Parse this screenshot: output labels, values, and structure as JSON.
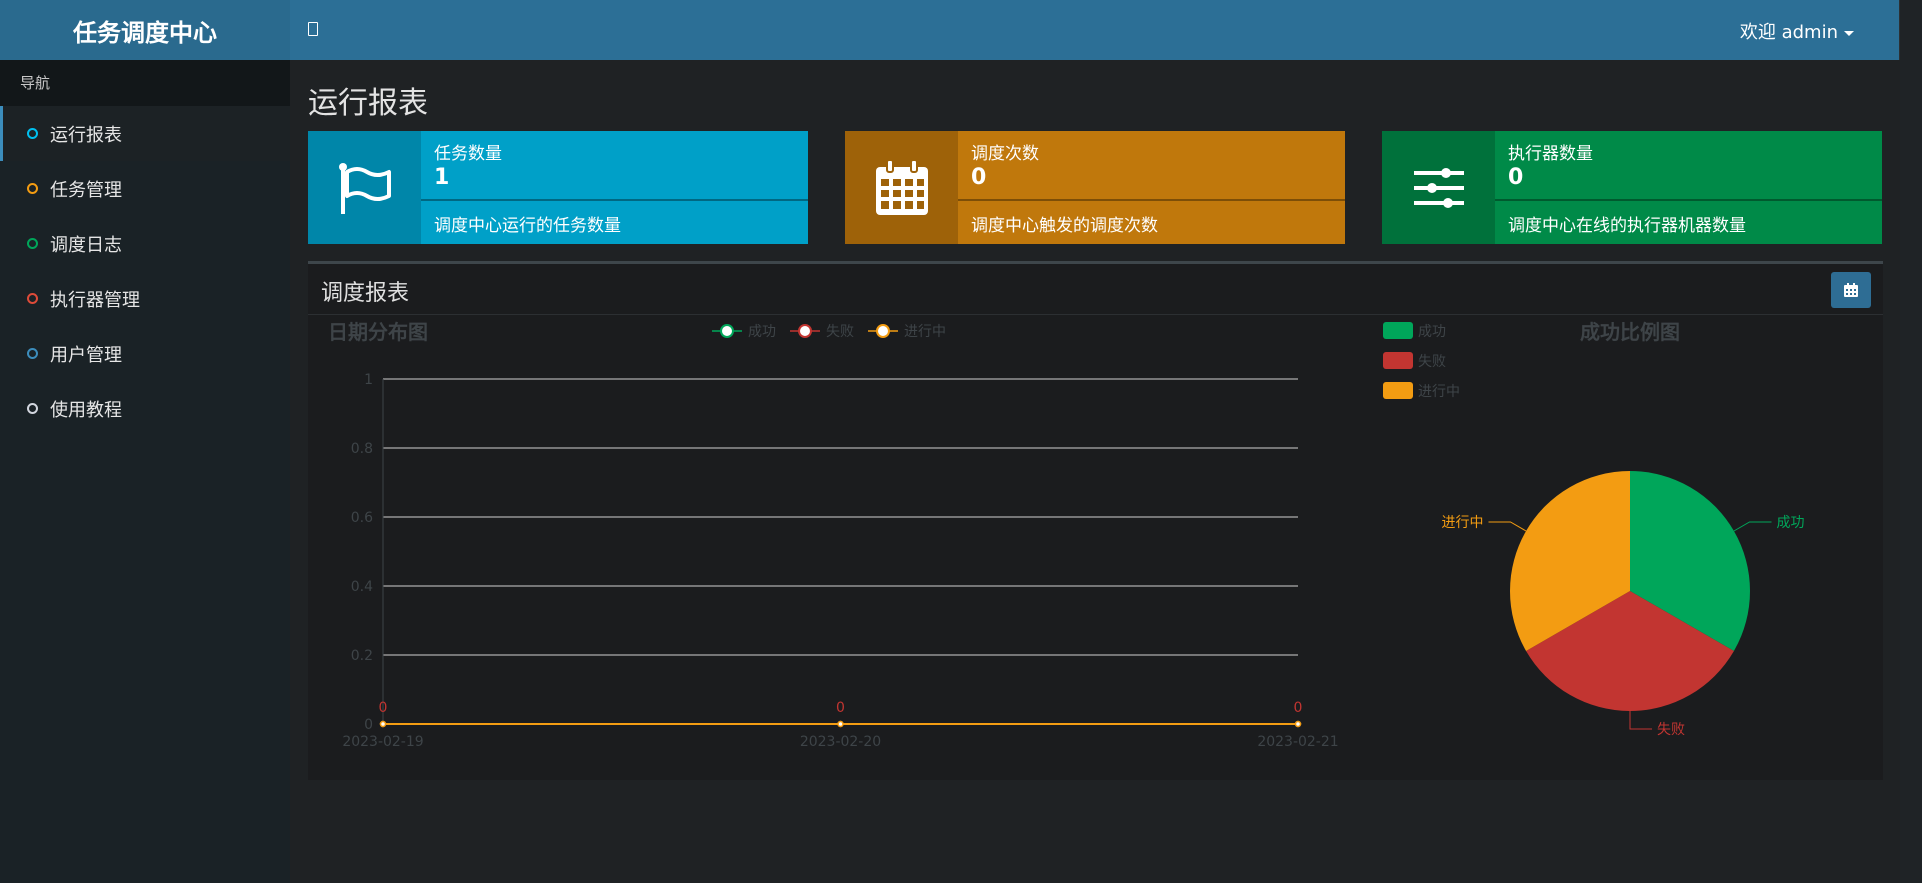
{
  "app": {
    "brand": "任务调度中心",
    "user_label": "欢迎 admin"
  },
  "sidebar": {
    "title": "导航",
    "items": [
      {
        "label": "运行报表",
        "color": "#00c0ef"
      },
      {
        "label": "任务管理",
        "color": "#f39c12"
      },
      {
        "label": "调度日志",
        "color": "#00a65a"
      },
      {
        "label": "执行器管理",
        "color": "#dd4b39"
      },
      {
        "label": "用户管理",
        "color": "#3c8dbc"
      },
      {
        "label": "使用教程",
        "color": "#d2d6de"
      }
    ]
  },
  "page": {
    "title": "运行报表"
  },
  "info_boxes": [
    {
      "label": "任务数量",
      "value": "1",
      "desc": "调度中心运行的任务数量",
      "icon": "flag-icon",
      "color": "#00a0c8",
      "icon_bg": "#0086a9"
    },
    {
      "label": "调度次数",
      "value": "0",
      "desc": "调度中心触发的调度次数",
      "icon": "calendar-icon",
      "color": "#c0780c",
      "icon_bg": "#9e6209"
    },
    {
      "label": "执行器数量",
      "value": "0",
      "desc": "调度中心在线的执行器机器数量",
      "icon": "sliders-icon",
      "color": "#008a48",
      "icon_bg": "#00713b"
    }
  ],
  "report": {
    "title": "调度报表",
    "button_icon": "calendar-icon"
  },
  "chart_data": [
    {
      "type": "line",
      "title": "日期分布图",
      "x": [
        "2023-02-19",
        "2023-02-20",
        "2023-02-21"
      ],
      "y_ticks": [
        "0",
        "0.2",
        "0.4",
        "0.6",
        "0.8",
        "1"
      ],
      "ylim": [
        0,
        1
      ],
      "grid": true,
      "series": [
        {
          "name": "成功",
          "values": [
            0,
            0,
            0
          ],
          "color": "#00a65a"
        },
        {
          "name": "失败",
          "values": [
            0,
            0,
            0
          ],
          "color": "#c23531"
        },
        {
          "name": "进行中",
          "values": [
            0,
            0,
            0
          ],
          "color": "#f39c12"
        }
      ],
      "data_labels": [
        "0",
        "0",
        "0"
      ],
      "legend": "top"
    },
    {
      "type": "pie",
      "title": "成功比例图",
      "legend": "top-left",
      "slices": [
        {
          "name": "成功",
          "value": 1,
          "color": "#00a65a"
        },
        {
          "name": "失败",
          "value": 1,
          "color": "#c23531"
        },
        {
          "name": "进行中",
          "value": 1,
          "color": "#f39c12"
        }
      ]
    }
  ]
}
